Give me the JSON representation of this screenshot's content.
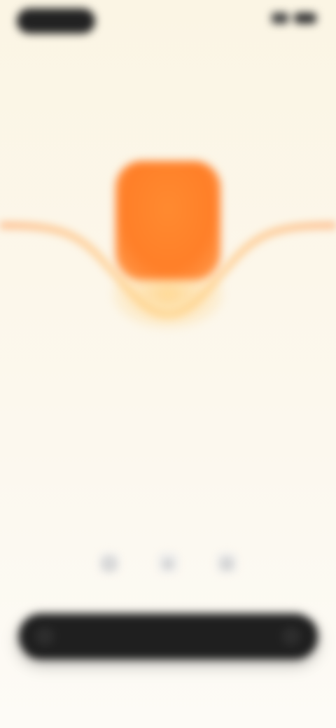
{
  "status_bar": {
    "time_pill_text": "",
    "signal_icon": "signal-icon",
    "battery_icon": "battery-icon"
  },
  "header": {
    "eyebrow": "",
    "title": "",
    "subtitle": ""
  },
  "hero": {
    "left_label": "",
    "right_label": "",
    "accent_color": "#ff7f28",
    "glow_color": "#ffd48a"
  },
  "middle": {
    "section_label": "",
    "highlight": "",
    "sub_line": ""
  },
  "share": {
    "label": "",
    "buttons": [
      {
        "icon": "share-icon-1",
        "label": ""
      },
      {
        "icon": "share-icon-2",
        "label": ""
      },
      {
        "icon": "share-icon-3",
        "label": ""
      }
    ]
  },
  "cta": {
    "label": "",
    "left_icon": "cta-left-icon",
    "right_icon": "cta-right-icon",
    "bg_color": "#1f1f1f"
  }
}
